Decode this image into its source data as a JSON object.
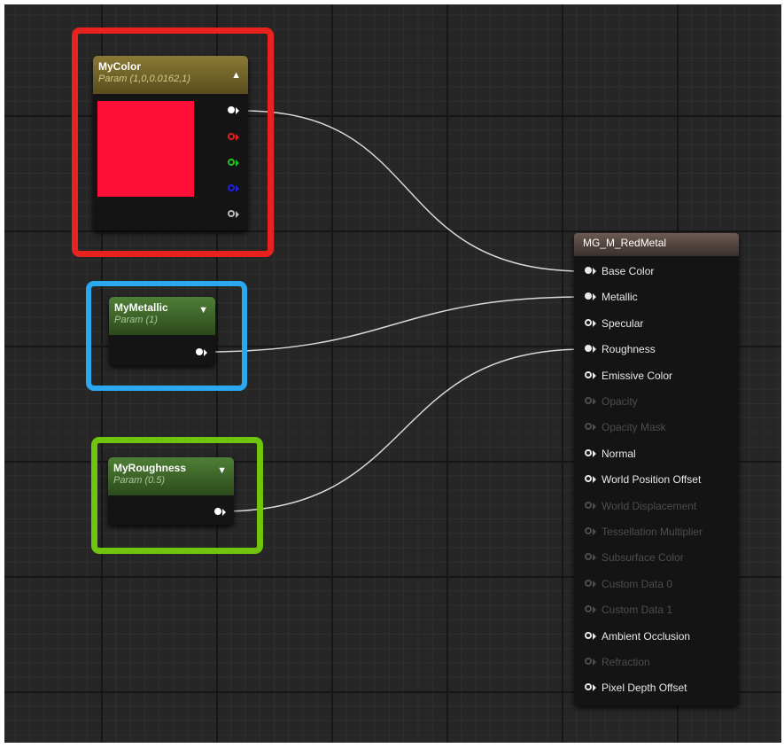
{
  "nodes": {
    "color": {
      "title": "MyColor",
      "subtitle": "Param (1,0,0.0162,1)",
      "collapse_icon": "triangle-up-icon",
      "swatch_color": "#ff0f37",
      "pins": [
        "rgba",
        "r",
        "g",
        "b",
        "a"
      ]
    },
    "metallic": {
      "title": "MyMetallic",
      "subtitle": "Param (1)",
      "collapse_icon": "triangle-down-icon"
    },
    "roughness": {
      "title": "MyRoughness",
      "subtitle": "Param (0.5)",
      "collapse_icon": "triangle-down-icon"
    }
  },
  "material": {
    "title": "MG_M_RedMetal",
    "inputs": [
      {
        "label": "Base Color",
        "connected": true,
        "enabled": true
      },
      {
        "label": "Metallic",
        "connected": true,
        "enabled": true
      },
      {
        "label": "Specular",
        "connected": false,
        "enabled": true
      },
      {
        "label": "Roughness",
        "connected": true,
        "enabled": true
      },
      {
        "label": "Emissive Color",
        "connected": false,
        "enabled": true
      },
      {
        "label": "Opacity",
        "connected": false,
        "enabled": false
      },
      {
        "label": "Opacity Mask",
        "connected": false,
        "enabled": false
      },
      {
        "label": "Normal",
        "connected": false,
        "enabled": true
      },
      {
        "label": "World Position Offset",
        "connected": false,
        "enabled": true
      },
      {
        "label": "World Displacement",
        "connected": false,
        "enabled": false
      },
      {
        "label": "Tessellation Multiplier",
        "connected": false,
        "enabled": false
      },
      {
        "label": "Subsurface Color",
        "connected": false,
        "enabled": false
      },
      {
        "label": "Custom Data 0",
        "connected": false,
        "enabled": false
      },
      {
        "label": "Custom Data 1",
        "connected": false,
        "enabled": false
      },
      {
        "label": "Ambient Occlusion",
        "connected": false,
        "enabled": true
      },
      {
        "label": "Refraction",
        "connected": false,
        "enabled": false
      },
      {
        "label": "Pixel Depth Offset",
        "connected": false,
        "enabled": true
      }
    ]
  },
  "colors": {
    "graph_bg": "#262626",
    "highlight_color": "#e8231f",
    "highlight_metallic": "#2aa8f0",
    "highlight_roughness": "#6fc50e",
    "vector_header": "#7a6a2c",
    "scalar_header": "#3f6a28",
    "wire": "#d8d8d8",
    "pin_r": "#e02020",
    "pin_g": "#20c020",
    "pin_b": "#2020e0"
  }
}
